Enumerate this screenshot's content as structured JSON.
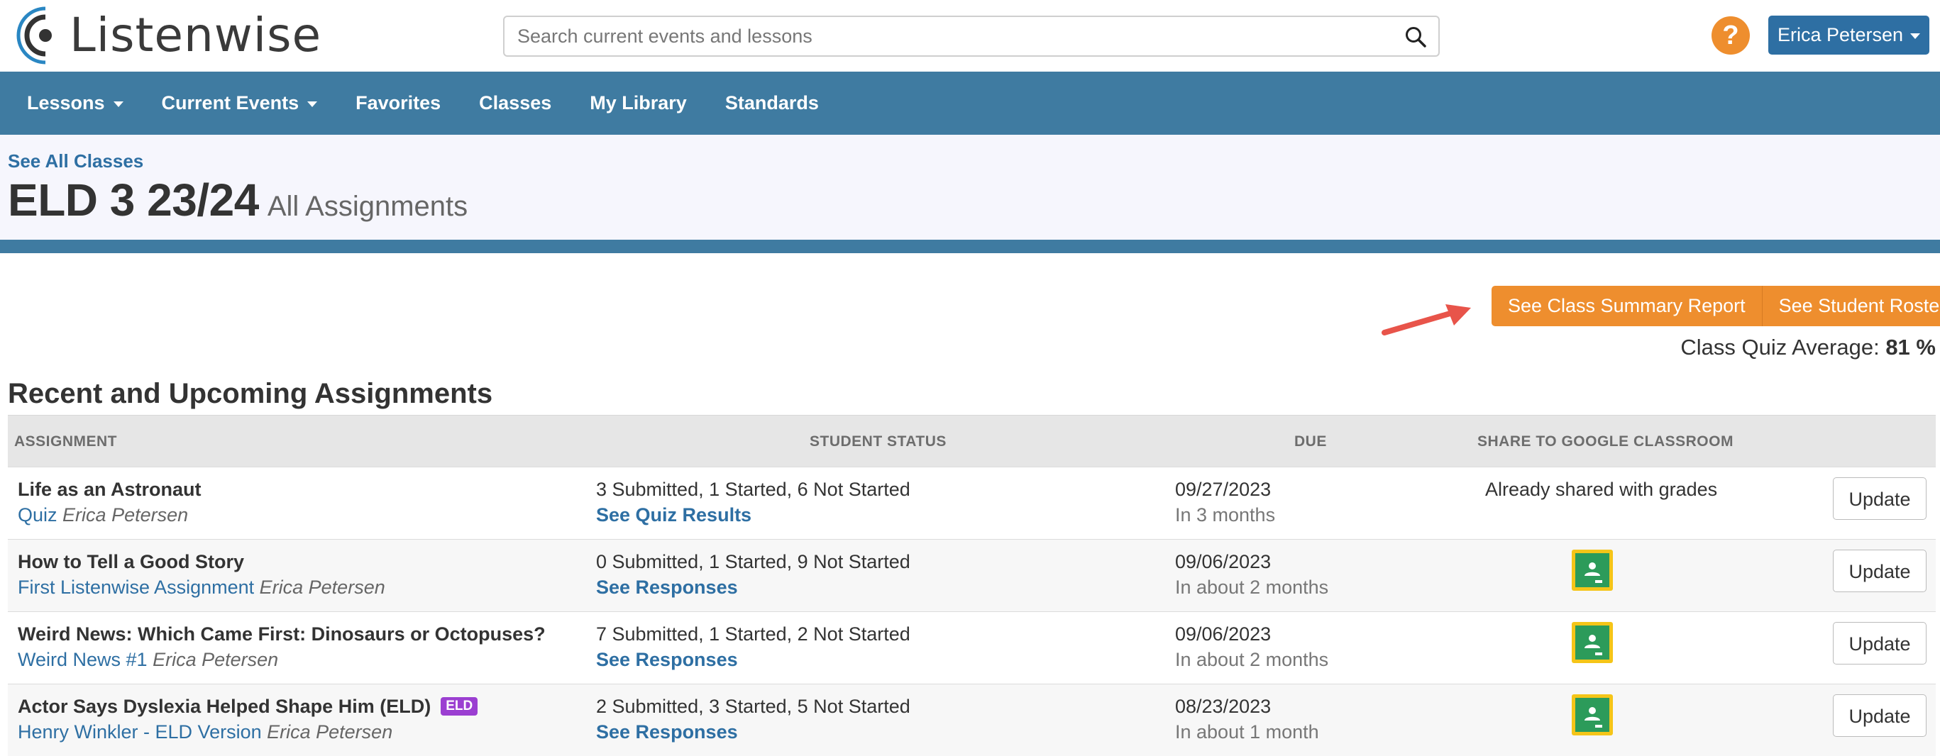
{
  "brand": {
    "name": "Listenwise"
  },
  "search": {
    "placeholder": "Search current events and lessons"
  },
  "user": {
    "name": "Erica Petersen",
    "help": "?"
  },
  "nav": {
    "items": [
      {
        "label": "Lessons",
        "dropdown": true
      },
      {
        "label": "Current Events",
        "dropdown": true
      },
      {
        "label": "Favorites"
      },
      {
        "label": "Classes"
      },
      {
        "label": "My Library"
      },
      {
        "label": "Standards"
      }
    ]
  },
  "page": {
    "back_link": "See All Classes",
    "class_name": "ELD 3 23/24",
    "subtitle": "All Assignments"
  },
  "actions": {
    "summary": "See Class Summary Report",
    "roster": "See Student Roster"
  },
  "quiz_average": {
    "label": "Class Quiz Average:",
    "value": "81",
    "unit": "%"
  },
  "assignments": {
    "title": "Recent and Upcoming Assignments",
    "columns": [
      "ASSIGNMENT",
      "STUDENT STATUS",
      "DUE",
      "SHARE TO GOOGLE CLASSROOM"
    ],
    "update_label": "Update",
    "rows": [
      {
        "title": "Life as an Astronaut",
        "type": "Quiz",
        "author": "Erica Petersen",
        "status": "3 Submitted, 1 Started, 6 Not Started",
        "link": "See Quiz Results",
        "due_date": "09/27/2023",
        "due_relative": "In 3 months",
        "share": "Already shared with grades"
      },
      {
        "title": "How to Tell a Good Story",
        "type": "First Listenwise Assignment",
        "author": "Erica Petersen",
        "status": "0 Submitted, 1 Started, 9 Not Started",
        "link": "See Responses",
        "due_date": "09/06/2023",
        "due_relative": "In about 2 months",
        "share_icon": "google-classroom-icon"
      },
      {
        "title": "Weird News: Which Came First: Dinosaurs or Octopuses?",
        "type": "Weird News #1",
        "author": "Erica Petersen",
        "status": "7 Submitted, 1 Started, 2 Not Started",
        "link": "See Responses",
        "due_date": "09/06/2023",
        "due_relative": "In about 2 months",
        "share_icon": "google-classroom-icon"
      },
      {
        "title": "Actor Says Dyslexia Helped Shape Him (ELD)",
        "badge": "ELD",
        "type": "Henry Winkler - ELD Version",
        "author": "Erica Petersen",
        "status": "2 Submitted, 3 Started, 5 Not Started",
        "link": "See Responses",
        "due_date": "08/23/2023",
        "due_relative": "In about 1 month",
        "share_icon": "google-classroom-icon"
      }
    ]
  },
  "colors": {
    "brand_blue": "#3f7ba1",
    "link_blue": "#2e6fa3",
    "accent_orange": "#ee8e2e",
    "badge_purple": "#9b3fd1",
    "classroom_green": "#2c9b5a",
    "classroom_yellow": "#f5c518",
    "arrow_red": "#e8544a"
  }
}
